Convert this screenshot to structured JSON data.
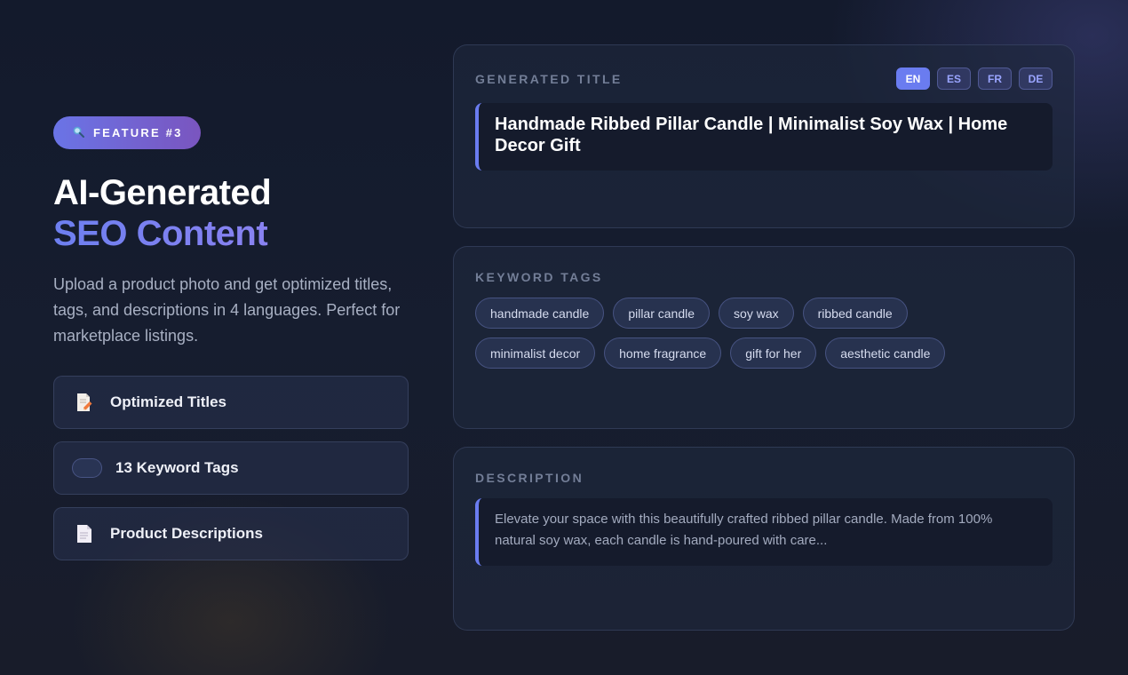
{
  "feature": {
    "badge_icon": "magnifier-icon",
    "badge_label": "FEATURE #3",
    "headline_line1": "AI-Generated",
    "headline_line2": "SEO Content",
    "description": "Upload a product photo and get optimized titles, tags, and descriptions in 4 languages. Perfect for marketplace listings.",
    "items": [
      {
        "icon": "pencil-document-icon",
        "label": "Optimized Titles"
      },
      {
        "icon": "tag-icon",
        "label": "13 Keyword Tags"
      },
      {
        "icon": "document-icon",
        "label": "Product Descriptions"
      }
    ]
  },
  "title_card": {
    "label": "GENERATED TITLE",
    "languages": [
      "EN",
      "ES",
      "FR",
      "DE"
    ],
    "active_language": "EN",
    "title": "Handmade Ribbed Pillar Candle | Minimalist Soy Wax | Home Decor Gift"
  },
  "keywords_card": {
    "label": "KEYWORD TAGS",
    "tags": [
      "handmade candle",
      "pillar candle",
      "soy wax",
      "ribbed candle",
      "minimalist decor",
      "home fragrance",
      "gift for her",
      "aesthetic candle"
    ]
  },
  "description_card": {
    "label": "DESCRIPTION",
    "text": "Elevate your space with this beautifully crafted ribbed pillar candle. Made from 100% natural soy wax, each candle is hand-poured with care..."
  },
  "colors": {
    "accent": "#6a7cf0",
    "badge_start": "#6a74e6",
    "badge_end": "#7a55bf"
  }
}
